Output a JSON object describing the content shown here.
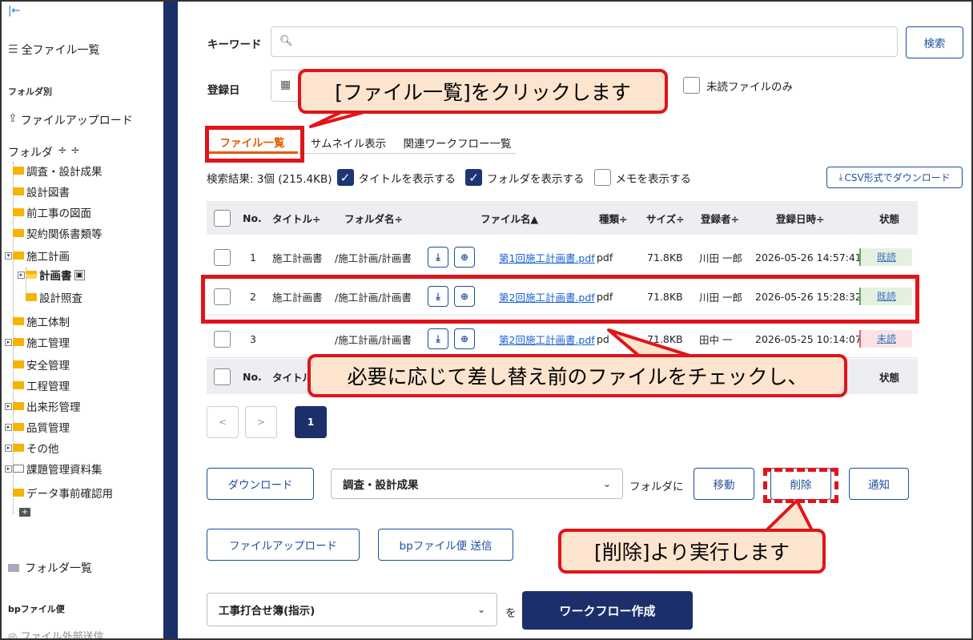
{
  "sidebar": {
    "collapse_icon": "collapse-left-icon",
    "all_files": "全ファイル一覧",
    "section_folder": "フォルダ別",
    "file_upload": "ファイルアップロード",
    "folder_label": "フォルダ",
    "folder_sort_icons": "÷ ÷",
    "tree": [
      {
        "label": "調査・設計成果",
        "level": 1
      },
      {
        "label": "設計図書",
        "level": 1
      },
      {
        "label": "前工事の図面",
        "level": 1
      },
      {
        "label": "契約関係書類等",
        "level": 1
      },
      {
        "label": "施工計画",
        "level": 1,
        "expanded": true
      },
      {
        "label": "計画書",
        "level": 2,
        "selected": true
      },
      {
        "label": "設計照査",
        "level": 2
      },
      {
        "label": "施工体制",
        "level": 1
      },
      {
        "label": "施工管理",
        "level": 1
      },
      {
        "label": "安全管理",
        "level": 1
      },
      {
        "label": "工程管理",
        "level": 1
      },
      {
        "label": "出来形管理",
        "level": 1
      },
      {
        "label": "品質管理",
        "level": 1
      },
      {
        "label": "その他",
        "level": 1
      },
      {
        "label": "課題管理資料集",
        "level": 1
      },
      {
        "label": "データ事前確認用",
        "level": 1
      }
    ],
    "folder_list": "フォルダ一覧",
    "section_bp": "bpファイル便",
    "external_send": "ファイル外部送信"
  },
  "search": {
    "keyword_label": "キーワード",
    "keyword_value": "",
    "search_button": "検索",
    "date_label": "登録日",
    "unread_only": "未読ファイルのみ"
  },
  "tabs": [
    {
      "label": "ファイル一覧",
      "active": true
    },
    {
      "label": "サムネイル表示",
      "active": false
    },
    {
      "label": "関連ワークフロー一覧",
      "active": false
    }
  ],
  "results": {
    "summary": "検索結果: 3個 (215.4KB)",
    "show_title": "タイトルを表示する",
    "show_folder": "フォルダを表示する",
    "show_memo": "メモを表示する",
    "csv_button": "CSV形式でダウンロード"
  },
  "table": {
    "headers": [
      "No.",
      "タイトル÷",
      "フォルダ名÷",
      "ファイル名▲",
      "種類÷",
      "サイズ÷",
      "登録者÷",
      "登録日時÷",
      "状態"
    ],
    "rows": [
      {
        "no": "1",
        "title": "施工計画書",
        "folder": "/施工計画/計画書",
        "file": "第1回施工計画書.pdf",
        "type": "pdf",
        "size": "71.8KB",
        "user": "川田 一郎",
        "date": "2026-05-26 14:57:41",
        "status": "既読"
      },
      {
        "no": "2",
        "title": "施工計画書",
        "folder": "/施工計画/計画書",
        "file": "第2回施工計画書.pdf",
        "type": "pdf",
        "size": "71.8KB",
        "user": "川田 一郎",
        "date": "2026-05-26 15:28:32",
        "status": "既読"
      },
      {
        "no": "3",
        "title": "",
        "folder": "/施工計画/計画書",
        "file": "第2回施工計画書.pdf",
        "type": "pd",
        "size": "71.8KB",
        "user": "田中 一",
        "date": "2026-05-25 10:14:07",
        "status": "未読"
      }
    ],
    "footer_headers": [
      "No.",
      "タイトル",
      "状態"
    ]
  },
  "pagination": {
    "prev": "<",
    "next": ">",
    "current": "1"
  },
  "actions": {
    "download": "ダウンロード",
    "folder_select": "調査・設計成果",
    "folder_suffix": "フォルダに",
    "move": "移動",
    "delete": "削除",
    "notify": "通知",
    "file_upload": "ファイルアップロード",
    "bp_send": "bpファイル便 送信",
    "workflow_select": "工事打合せ簿(指示)",
    "workflow_suffix": "を",
    "workflow_create": "ワークフロー作成"
  },
  "callouts": {
    "click_list": "[ファイル一覧]をクリックします",
    "check_files": "必要に応じて差し替え前のファイルをチェックし、",
    "delete_exec": "[削除]より実行します"
  },
  "colors": {
    "navy": "#1c2f6b",
    "accent_orange": "#e65c00",
    "callout_red": "#e0141a",
    "callout_fill": "#fde4cf"
  }
}
